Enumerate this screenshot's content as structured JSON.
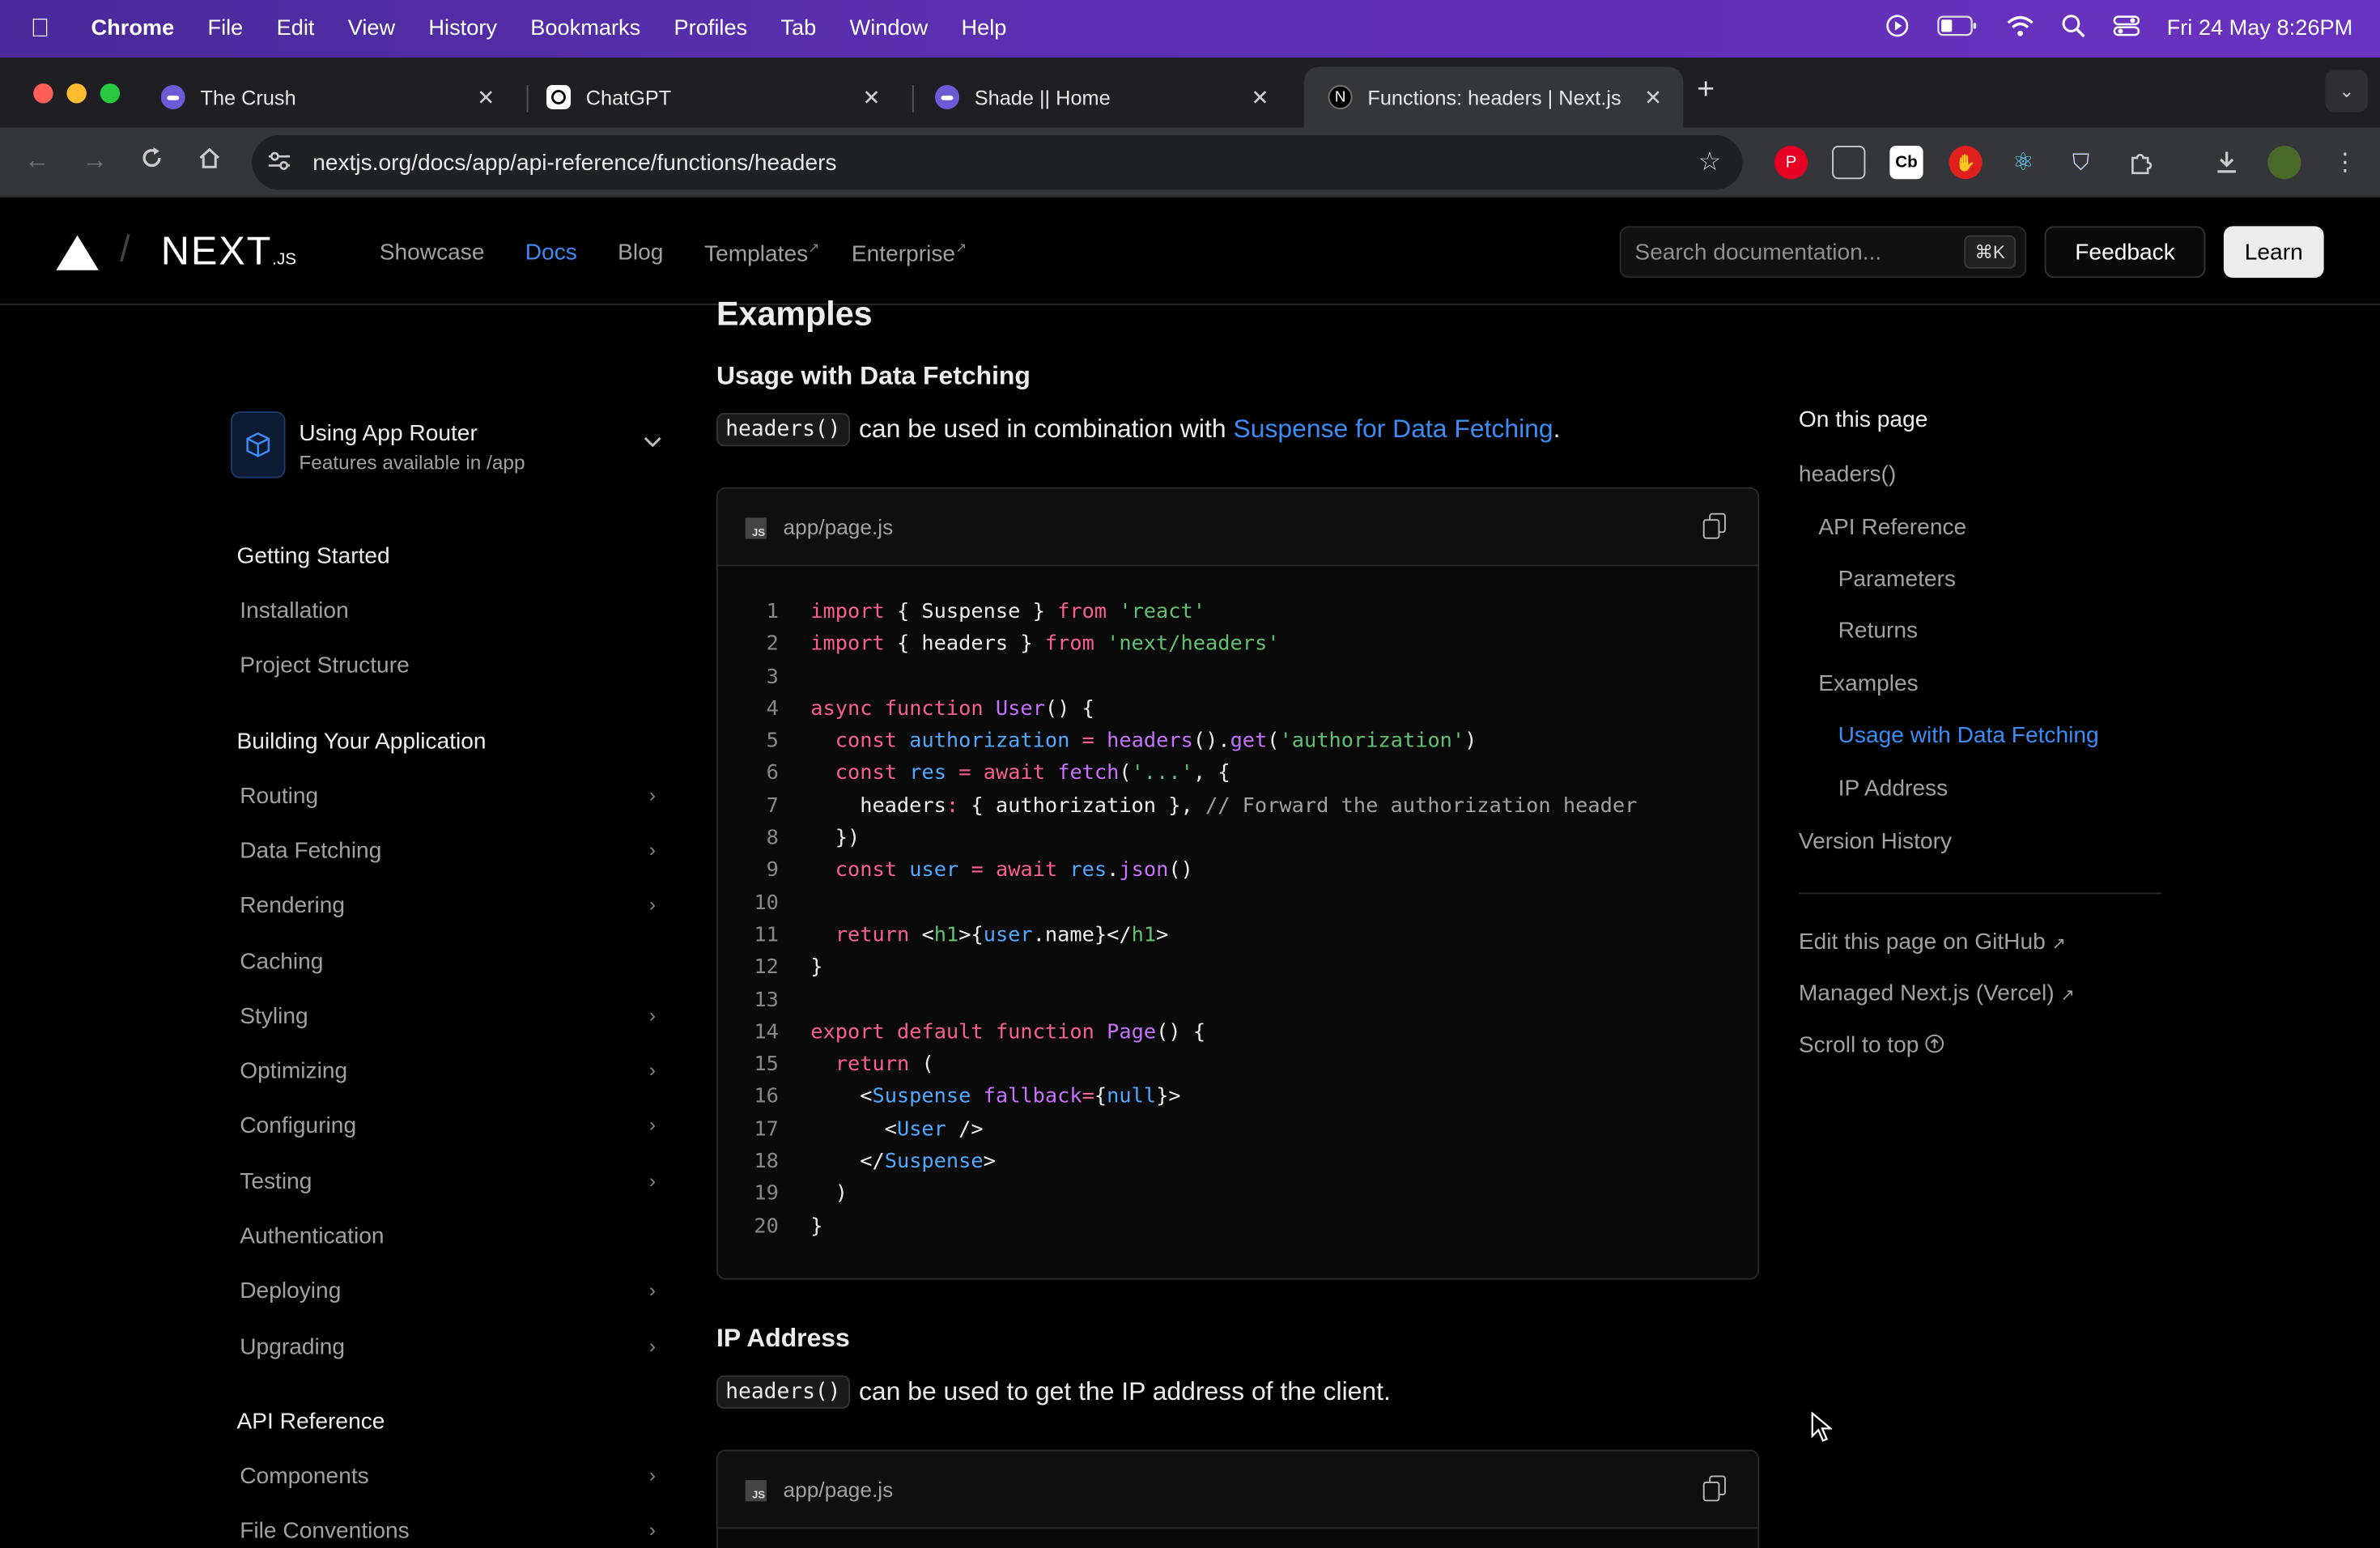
{
  "menubar": {
    "app": "Chrome",
    "items": [
      "File",
      "Edit",
      "View",
      "History",
      "Bookmarks",
      "Profiles",
      "Tab",
      "Window",
      "Help"
    ],
    "datetime": "Fri 24 May  8:26PM"
  },
  "tabs": [
    {
      "title": "The Crush",
      "icon": "crush-favicon"
    },
    {
      "title": "ChatGPT",
      "icon": "chatgpt-favicon"
    },
    {
      "title": "Shade || Home",
      "icon": "shade-favicon"
    },
    {
      "title": "Functions: headers | Next.js",
      "icon": "nextjs-favicon",
      "active": true
    }
  ],
  "toolbar": {
    "url": "nextjs.org/docs/app/api-reference/functions/headers"
  },
  "site": {
    "logo": "NEXT",
    "logo_suffix": ".JS",
    "nav": [
      "Showcase",
      "Docs",
      "Blog",
      "Templates",
      "Enterprise"
    ],
    "nav_ext_mark": "↗",
    "search_placeholder": "Search documentation...",
    "search_shortcut": "⌘K",
    "feedback": "Feedback",
    "learn": "Learn"
  },
  "sidebar": {
    "router_title": "Using App Router",
    "router_subtitle": "Features available in /app",
    "sections": [
      {
        "heading": "Getting Started",
        "items": [
          {
            "label": "Installation",
            "expandable": false
          },
          {
            "label": "Project Structure",
            "expandable": false
          }
        ]
      },
      {
        "heading": "Building Your Application",
        "items": [
          {
            "label": "Routing",
            "expandable": true
          },
          {
            "label": "Data Fetching",
            "expandable": true
          },
          {
            "label": "Rendering",
            "expandable": true
          },
          {
            "label": "Caching",
            "expandable": false
          },
          {
            "label": "Styling",
            "expandable": true
          },
          {
            "label": "Optimizing",
            "expandable": true
          },
          {
            "label": "Configuring",
            "expandable": true
          },
          {
            "label": "Testing",
            "expandable": true
          },
          {
            "label": "Authentication",
            "expandable": false
          },
          {
            "label": "Deploying",
            "expandable": true
          },
          {
            "label": "Upgrading",
            "expandable": true
          }
        ]
      },
      {
        "heading": "API Reference",
        "items": [
          {
            "label": "Components",
            "expandable": true
          },
          {
            "label": "File Conventions",
            "expandable": true
          }
        ]
      }
    ]
  },
  "main": {
    "examples_heading": "Examples",
    "usage_heading": "Usage with Data Fetching",
    "usage_code": "headers()",
    "usage_text": "can be used in combination with",
    "usage_link": "Suspense for Data Fetching",
    "usage_end": ".",
    "code1_filename": "app/page.js",
    "ip_heading": "IP Address",
    "ip_code": "headers()",
    "ip_text": "can be used to get the IP address of the client.",
    "code2_filename": "app/page.js"
  },
  "code_lines": [
    [
      [
        "key",
        "import"
      ],
      [
        "tx",
        " { Suspense } "
      ],
      [
        "key",
        "from"
      ],
      [
        "tx",
        " "
      ],
      [
        "str",
        "'react'"
      ]
    ],
    [
      [
        "key",
        "import"
      ],
      [
        "tx",
        " { headers } "
      ],
      [
        "key",
        "from"
      ],
      [
        "tx",
        " "
      ],
      [
        "str",
        "'next/headers'"
      ]
    ],
    [],
    [
      [
        "key",
        "async"
      ],
      [
        "tx",
        " "
      ],
      [
        "key",
        "function"
      ],
      [
        "tx",
        " "
      ],
      [
        "fn",
        "User"
      ],
      [
        "tx",
        "() {"
      ]
    ],
    [
      [
        "tx",
        "  "
      ],
      [
        "key",
        "const"
      ],
      [
        "tx",
        " "
      ],
      [
        "var",
        "authorization"
      ],
      [
        "tx",
        " "
      ],
      [
        "key",
        "="
      ],
      [
        "tx",
        " "
      ],
      [
        "fn",
        "headers"
      ],
      [
        "tx",
        "()."
      ],
      [
        "fn",
        "get"
      ],
      [
        "tx",
        "("
      ],
      [
        "str",
        "'authorization'"
      ],
      [
        "tx",
        ")"
      ]
    ],
    [
      [
        "tx",
        "  "
      ],
      [
        "key",
        "const"
      ],
      [
        "tx",
        " "
      ],
      [
        "var",
        "res"
      ],
      [
        "tx",
        " "
      ],
      [
        "key",
        "="
      ],
      [
        "tx",
        " "
      ],
      [
        "key",
        "await"
      ],
      [
        "tx",
        " "
      ],
      [
        "fn",
        "fetch"
      ],
      [
        "tx",
        "("
      ],
      [
        "str",
        "'...'"
      ],
      [
        "tx",
        ", {"
      ]
    ],
    [
      [
        "tx",
        "    headers"
      ],
      [
        "key",
        ":"
      ],
      [
        "tx",
        " { authorization }, "
      ],
      [
        "cm",
        "// Forward the authorization header"
      ]
    ],
    [
      [
        "tx",
        "  })"
      ]
    ],
    [
      [
        "tx",
        "  "
      ],
      [
        "key",
        "const"
      ],
      [
        "tx",
        " "
      ],
      [
        "var",
        "user"
      ],
      [
        "tx",
        " "
      ],
      [
        "key",
        "="
      ],
      [
        "tx",
        " "
      ],
      [
        "key",
        "await"
      ],
      [
        "tx",
        " "
      ],
      [
        "var",
        "res"
      ],
      [
        "tx",
        "."
      ],
      [
        "fn",
        "json"
      ],
      [
        "tx",
        "()"
      ]
    ],
    [],
    [
      [
        "tx",
        "  "
      ],
      [
        "key",
        "return"
      ],
      [
        "tx",
        " <"
      ],
      [
        "tag",
        "h1"
      ],
      [
        "tx",
        ">{"
      ],
      [
        "var",
        "user"
      ],
      [
        "tx",
        ".name}</"
      ],
      [
        "tag",
        "h1"
      ],
      [
        "tx",
        ">"
      ]
    ],
    [
      [
        "tx",
        "}"
      ]
    ],
    [],
    [
      [
        "key",
        "export"
      ],
      [
        "tx",
        " "
      ],
      [
        "key",
        "default"
      ],
      [
        "tx",
        " "
      ],
      [
        "key",
        "function"
      ],
      [
        "tx",
        " "
      ],
      [
        "fn",
        "Page"
      ],
      [
        "tx",
        "() {"
      ]
    ],
    [
      [
        "tx",
        "  "
      ],
      [
        "key",
        "return"
      ],
      [
        "tx",
        " ("
      ]
    ],
    [
      [
        "tx",
        "    <"
      ],
      [
        "var",
        "Suspense"
      ],
      [
        "tx",
        " "
      ],
      [
        "fn",
        "fallback"
      ],
      [
        "key",
        "="
      ],
      [
        "tx",
        "{"
      ],
      [
        "var",
        "null"
      ],
      [
        "tx",
        "}>"
      ]
    ],
    [
      [
        "tx",
        "      <"
      ],
      [
        "var",
        "User"
      ],
      [
        "tx",
        " />"
      ]
    ],
    [
      [
        "tx",
        "    </"
      ],
      [
        "var",
        "Suspense"
      ],
      [
        "tx",
        ">"
      ]
    ],
    [
      [
        "tx",
        "  )"
      ]
    ],
    [
      [
        "tx",
        "}"
      ]
    ]
  ],
  "toc": {
    "heading": "On this page",
    "items": [
      {
        "label": "headers()",
        "level": 0
      },
      {
        "label": "API Reference",
        "level": 1
      },
      {
        "label": "Parameters",
        "level": 2
      },
      {
        "label": "Returns",
        "level": 2
      },
      {
        "label": "Examples",
        "level": 1
      },
      {
        "label": "Usage with Data Fetching",
        "level": 2,
        "active": true
      },
      {
        "label": "IP Address",
        "level": 2
      },
      {
        "label": "Version History",
        "level": 0
      }
    ],
    "edit_github": "Edit this page on GitHub",
    "managed": "Managed Next.js (Vercel)",
    "scroll_top": "Scroll to top"
  },
  "colors": {
    "accent": "#3b8df5",
    "keyword": "#f75f8f",
    "string": "#62c073",
    "function": "#c472fb",
    "variable": "#52a8ff"
  }
}
